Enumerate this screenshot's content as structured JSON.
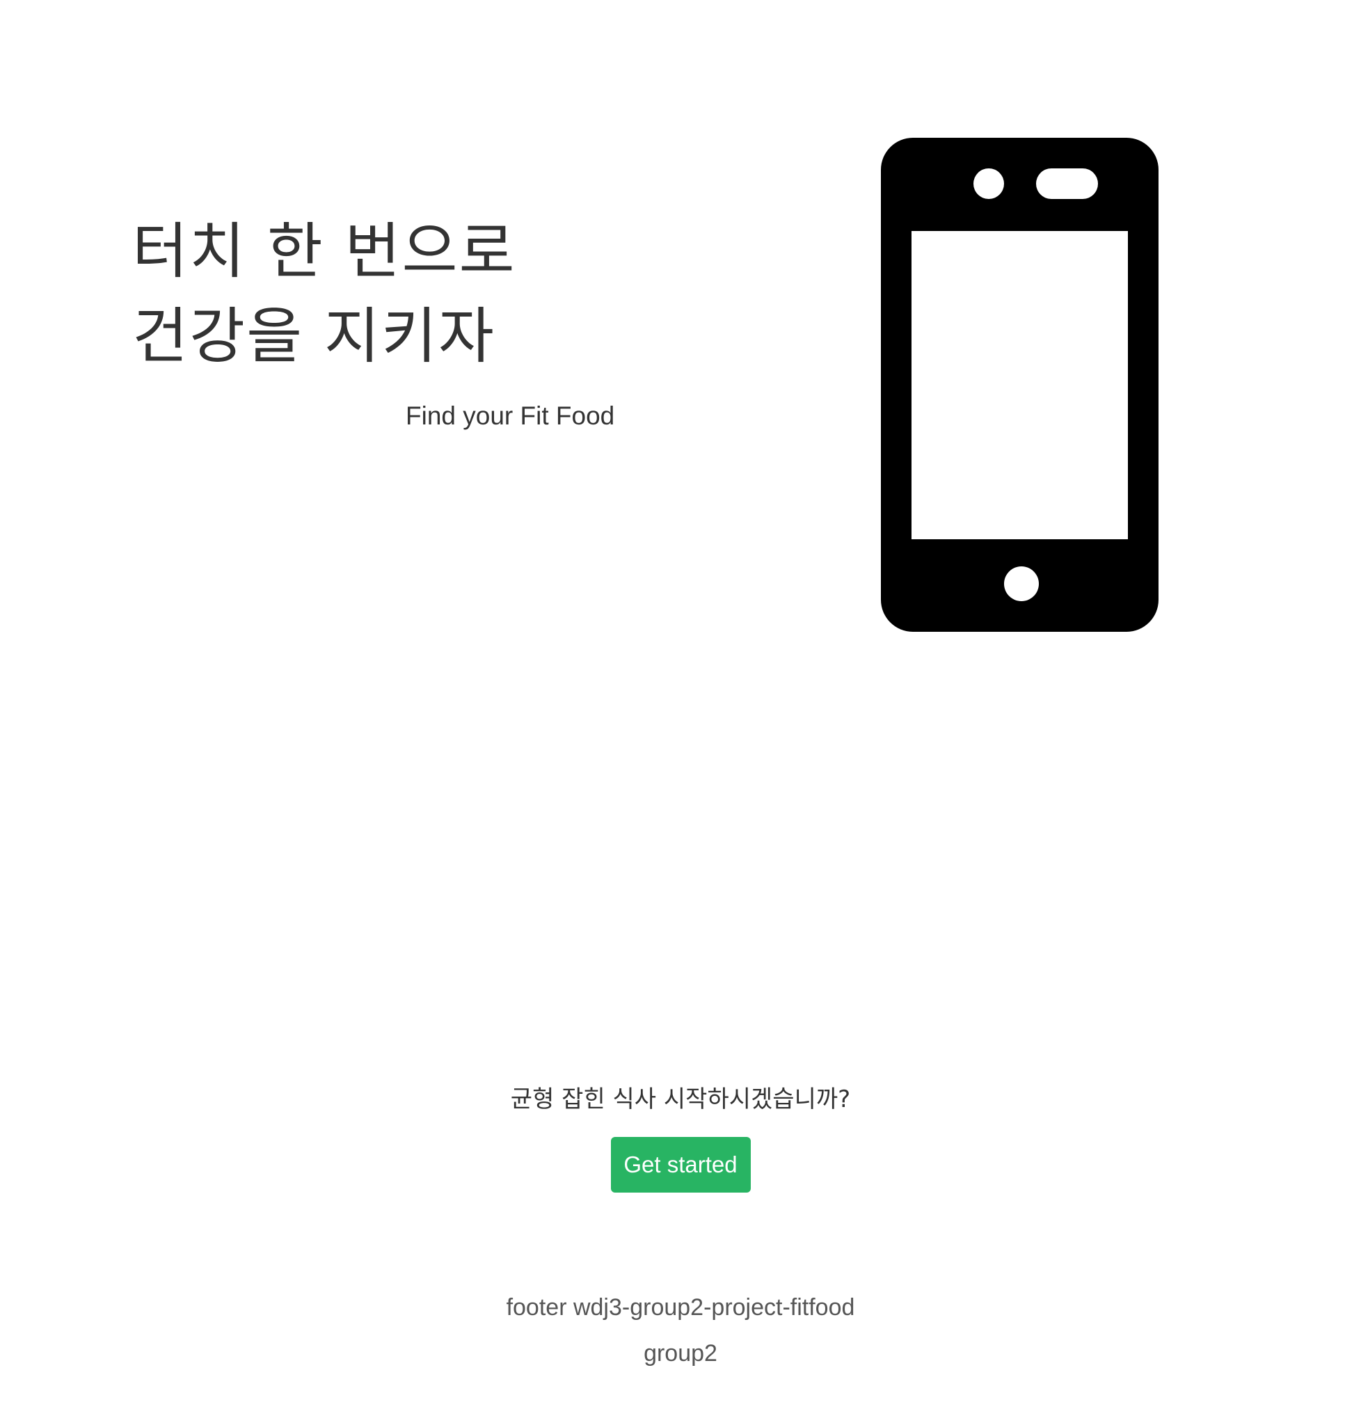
{
  "hero": {
    "title_line1": "터치 한 번으로",
    "title_line2": "건강을 지키자",
    "subtitle": "Find your Fit Food",
    "illustration_icon": "mobile-phone-icon"
  },
  "cta": {
    "question": "균형 잡힌 식사 시작하시겠습니까?",
    "button_label": "Get started",
    "button_color": "#28b463"
  },
  "footer": {
    "line1": "footer wdj3-group2-project-fitfood",
    "line2": "group2"
  }
}
